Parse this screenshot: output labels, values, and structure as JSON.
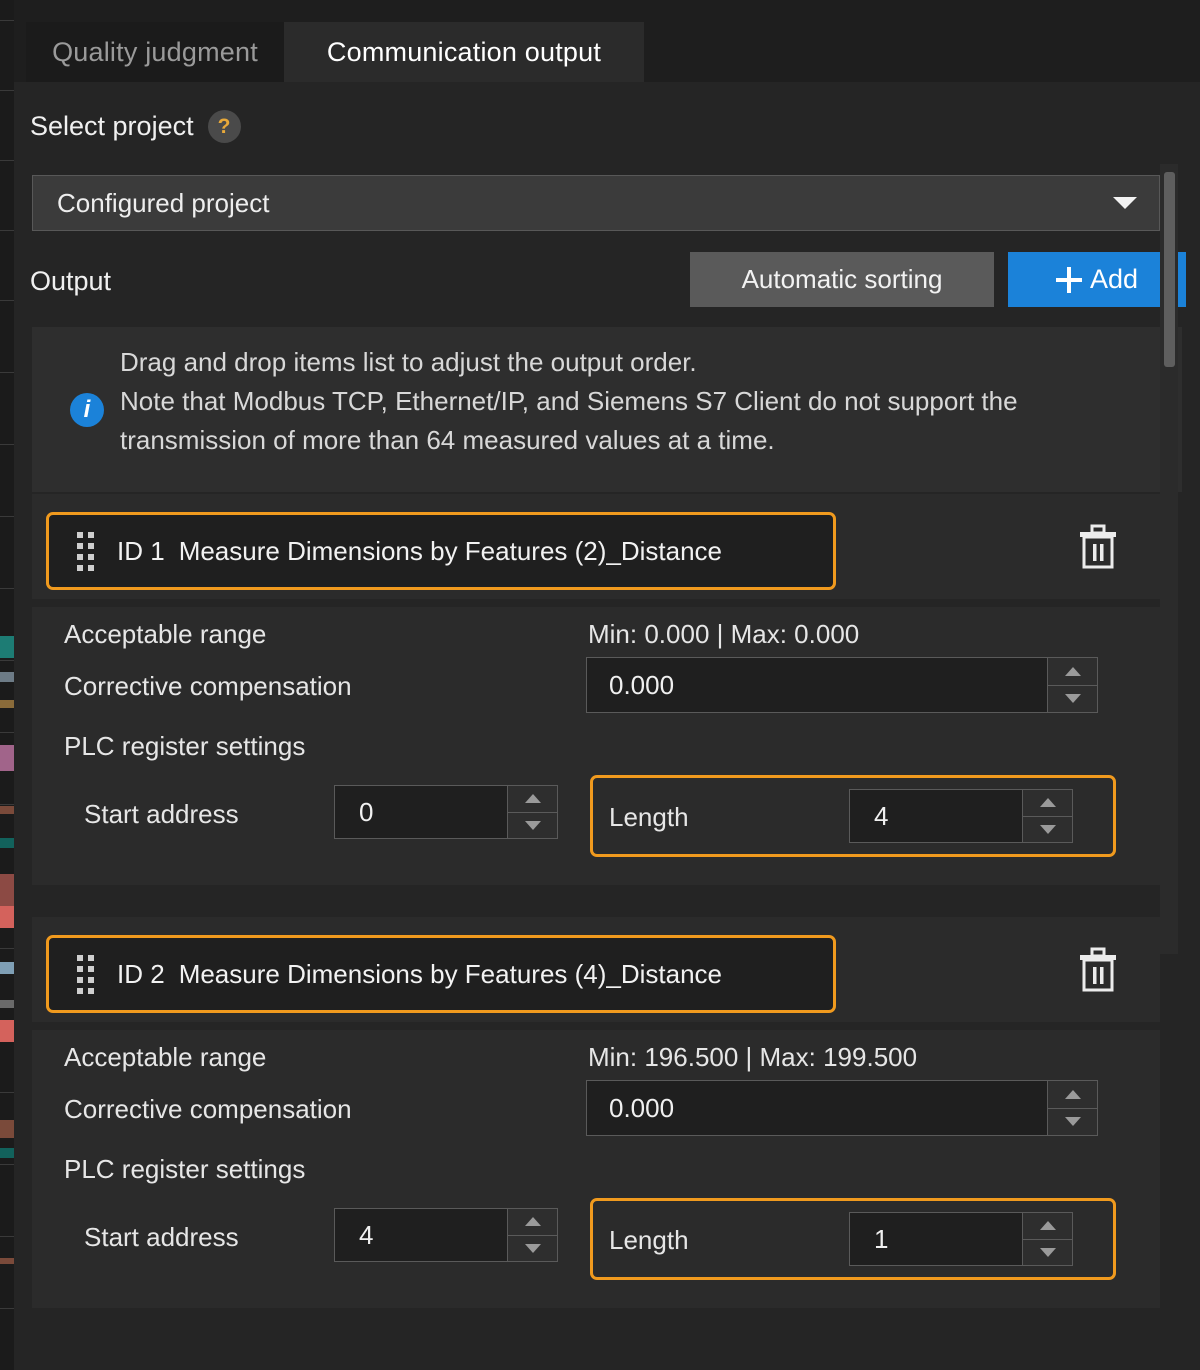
{
  "tabs": [
    {
      "label": "Quality judgment",
      "active": false
    },
    {
      "label": "Communication output",
      "active": true
    }
  ],
  "select_project": {
    "label": "Select project",
    "help_badge": "?",
    "dropdown_value": "Configured project"
  },
  "output_section": {
    "title": "Output",
    "automatic_sorting_label": "Automatic sorting",
    "add_label": "Add"
  },
  "note": {
    "line1": "Drag and drop items list to adjust the output order.",
    "line2": "Note that Modbus TCP, Ethernet/IP, and Siemens S7 Client do not support the",
    "line3": "transmission of more than 64 measured values at a time.",
    "icon_letter": "i"
  },
  "labels": {
    "acceptable_range": "Acceptable range",
    "corrective_compensation": "Corrective compensation",
    "plc_register_settings": "PLC register settings",
    "start_address": "Start address",
    "length": "Length"
  },
  "items": [
    {
      "id_text": "ID 1",
      "name": "Measure Dimensions by Features (2)_Distance",
      "acceptable_range_value": "Min: 0.000 | Max: 0.000",
      "corrective_compensation_value": "0.000",
      "start_address_value": "0",
      "length_value": "4"
    },
    {
      "id_text": "ID 2",
      "name": "Measure Dimensions by Features (4)_Distance",
      "acceptable_range_value": "Min: 196.500 | Max: 199.500",
      "corrective_compensation_value": "0.000",
      "start_address_value": "4",
      "length_value": "1"
    }
  ],
  "colors": {
    "accent_orange": "#f09a1e",
    "accent_blue": "#1b82d9",
    "panel_bg": "#2b2b2b",
    "window_bg": "#252525",
    "help_amber": "#e8a93a"
  }
}
